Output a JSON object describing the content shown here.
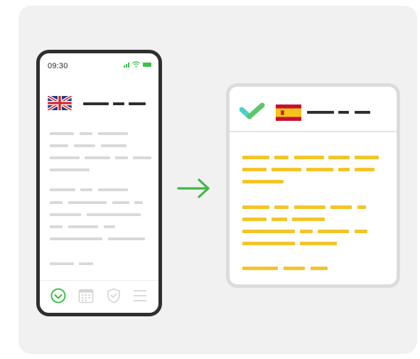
{
  "phone": {
    "status_time": "09:30",
    "source_language_flag": "uk-flag-icon",
    "tabs": [
      {
        "icon": "check-circle-icon",
        "active": true
      },
      {
        "icon": "calendar-icon",
        "active": false
      },
      {
        "icon": "shield-check-icon",
        "active": false
      },
      {
        "icon": "menu-icon",
        "active": false
      }
    ]
  },
  "arrow": {
    "icon": "arrow-right-icon"
  },
  "translated_card": {
    "logo_icon": "checkmark-logo-icon",
    "target_language_flag": "spain-flag-icon"
  },
  "colors": {
    "accent_green": "#3bbf4b",
    "text_highlight_yellow": "#f2c52a",
    "logo_teal": "#4fd1c5",
    "logo_green": "#5cc76b",
    "placeholder_gray": "#d9d9d9",
    "phone_frame": "#2f2f31",
    "background_panel": "#f1f1f1"
  }
}
